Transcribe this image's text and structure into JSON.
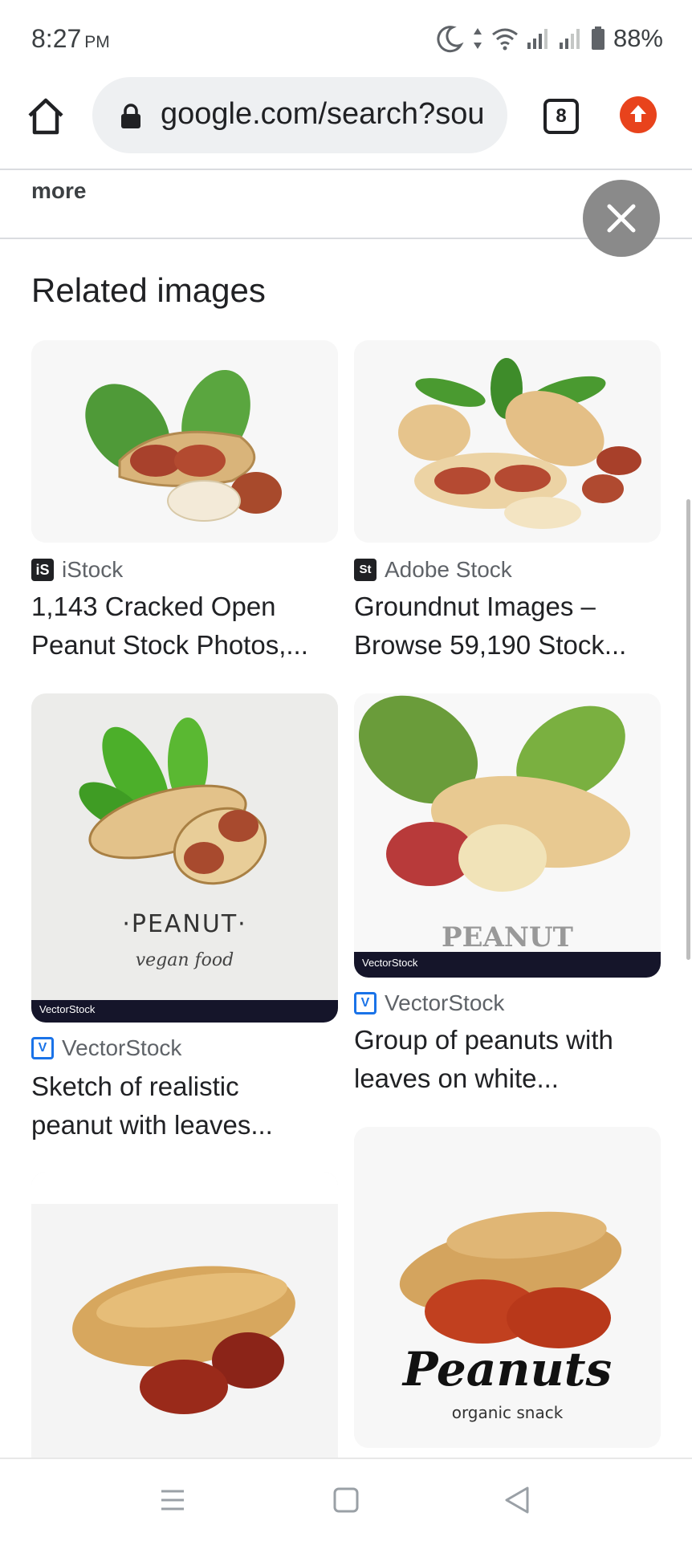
{
  "status_bar": {
    "time": "8:27",
    "ampm": "PM",
    "battery": "88%"
  },
  "toolbar": {
    "url": "google.com/search?sou",
    "tab_count": "8"
  },
  "more_label": "more",
  "section_title": "Related images",
  "cards": [
    {
      "source": "iStock",
      "title_line1": "1,143 Cracked Open",
      "title_line2": "Peanut Stock Photos,..."
    },
    {
      "source": "Adobe Stock",
      "title_line1": "Groundnut Images –",
      "title_line2": "Browse 59,190 Stock..."
    },
    {
      "source": "VectorStock",
      "title_line1": "Sketch of realistic",
      "title_line2": "peanut with leaves...",
      "img_text1": "·PEANUT·",
      "img_text2": "vegan food",
      "img_brand": "VectorStock"
    },
    {
      "source": "VectorStock",
      "title_line1": "Group of peanuts with",
      "title_line2": "leaves on white...",
      "img_text1": "PEANUT",
      "img_brand": "VectorStock"
    },
    {
      "source": "",
      "title_line1": "",
      "title_line2": ""
    },
    {
      "source": "",
      "title_line1": "",
      "title_line2": "",
      "img_text1": "Peanuts",
      "img_text2": "organic snack"
    }
  ],
  "colors": {
    "accent_update": "#e8431c",
    "istock": "#202124",
    "adobe": "#202124",
    "vectorstock": "#1a73e8"
  }
}
